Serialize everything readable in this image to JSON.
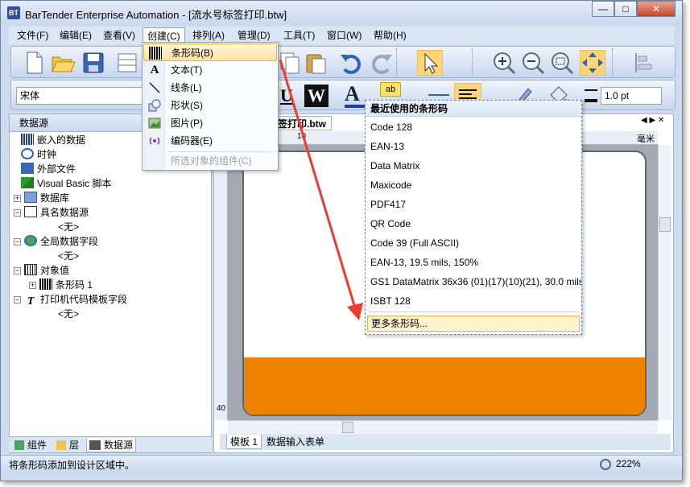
{
  "window": {
    "title": "BarTender Enterprise Automation - [流水号标签打印.btw]",
    "app_icon_label": "BT",
    "minimize": "—",
    "maximize": "□",
    "close": "✕"
  },
  "menubar": {
    "items": [
      "文件(F)",
      "编辑(E)",
      "查看(V)",
      "创建(C)",
      "排列(A)",
      "管理(D)",
      "工具(T)",
      "窗口(W)",
      "帮助(H)"
    ],
    "active_index": 3
  },
  "create_menu": {
    "items": [
      {
        "label": "条形码(B)",
        "icon": "barcode-icon",
        "selected": true,
        "disabled": false
      },
      {
        "label": "文本(T)",
        "icon": "text-icon",
        "selected": false,
        "disabled": false
      },
      {
        "label": "线条(L)",
        "icon": "line-icon",
        "selected": false,
        "disabled": false
      },
      {
        "label": "形状(S)",
        "icon": "shape-icon",
        "selected": false,
        "disabled": false
      },
      {
        "label": "图片(P)",
        "icon": "picture-icon",
        "selected": false,
        "disabled": false
      },
      {
        "label": "编码器(E)",
        "icon": "encoder-icon",
        "selected": false,
        "disabled": false
      },
      {
        "label": "所选对象的组件(C)",
        "icon": "",
        "selected": false,
        "disabled": true
      }
    ]
  },
  "toolbar2": {
    "font_name": "宋体",
    "underline_label": "U",
    "w_label": "W",
    "a_label": "A",
    "ab_label": "ab",
    "line_width": "1.0 pt"
  },
  "left_panel": {
    "header": "数据源",
    "tree": [
      {
        "label": "嵌入的数据",
        "icon": "embedded-data-icon",
        "level": 1,
        "expander": ""
      },
      {
        "label": "时钟",
        "icon": "clock-icon",
        "level": 1,
        "expander": ""
      },
      {
        "label": "外部文件",
        "icon": "external-file-icon",
        "level": 1,
        "expander": ""
      },
      {
        "label": "Visual Basic 脚本",
        "icon": "vb-script-icon",
        "level": 1,
        "expander": ""
      },
      {
        "label": "数据库",
        "icon": "database-icon",
        "level": 0,
        "expander": "+"
      },
      {
        "label": "具名数据源",
        "icon": "named-datasource-icon",
        "level": 0,
        "expander": "−"
      },
      {
        "label": "<无>",
        "icon": "",
        "level": 2,
        "expander": ""
      },
      {
        "label": "全局数据字段",
        "icon": "globe-icon",
        "level": 0,
        "expander": "−"
      },
      {
        "label": "<无>",
        "icon": "",
        "level": 2,
        "expander": ""
      },
      {
        "label": "对象值",
        "icon": "object-value-icon",
        "level": 0,
        "expander": "−"
      },
      {
        "label": "条形码 1",
        "icon": "barcode-icon",
        "level": 1,
        "expander": "+"
      },
      {
        "label": "打印机代码模板字段",
        "icon": "template-field-icon",
        "level": 0,
        "expander": "−"
      },
      {
        "label": "<无>",
        "icon": "",
        "level": 2,
        "expander": ""
      }
    ],
    "tabs": [
      "组件",
      "层",
      "数据源"
    ],
    "active_tab": 2
  },
  "document": {
    "tab_label": "签打印.btw",
    "ruler_mark": "10",
    "ruler_unit": "毫米",
    "ruler_left_mark": "40",
    "sheet_tabs": [
      "模板 1",
      "数据输入表单"
    ],
    "label_band_color": "#ee8300"
  },
  "barcode_menu": {
    "header": "最近使用的条形码",
    "items": [
      "Code 128",
      "EAN-13",
      "Data Matrix",
      "Maxicode",
      "PDF417",
      "QR Code",
      "Code 39 (Full ASCII)",
      "EAN-13, 19.5 mils, 150%",
      "GS1 DataMatrix 36x36 (01)(17)(10)(21), 30.0 mils",
      "ISBT 128"
    ],
    "more": "更多条形码..."
  },
  "statusbar": {
    "text": "将条形码添加到设计区域中。",
    "zoom": "222%"
  },
  "colors": {
    "accent": "#ee8300",
    "arrow": "#ea3c2e"
  }
}
